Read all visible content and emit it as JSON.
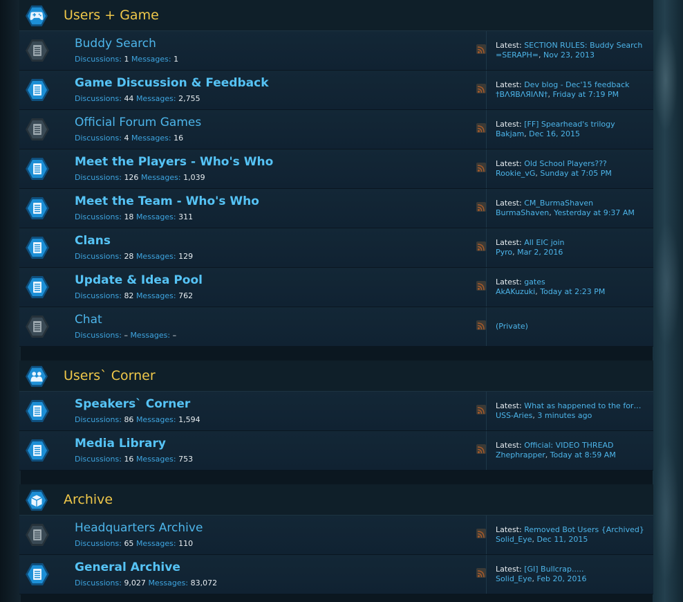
{
  "colors": {
    "category_title": "#f0c84a",
    "link": "#4db5ea",
    "number": "#e8eef2",
    "icon_active": "#1d8fd6",
    "icon_inactive": "#3a4a55"
  },
  "categories": [
    {
      "title": "Users + Game",
      "icon": "gamepad-icon",
      "nodes": [
        {
          "title": "Buddy Search",
          "bold": false,
          "unread": false,
          "discussions": "1",
          "messages": "1",
          "latest_title": "SECTION RULES: Buddy Search",
          "latest_user": "=SERAPH=",
          "latest_date": "Nov 23, 2013"
        },
        {
          "title": "Game Discussion & Feedback",
          "bold": true,
          "unread": true,
          "discussions": "44",
          "messages": "2,755",
          "latest_title": "Dev blog - Dec'15 feedback",
          "latest_user": "†BΛЯBΛЯIΛN†",
          "latest_date": "Friday at 7:19 PM"
        },
        {
          "title": "Official Forum Games",
          "bold": false,
          "unread": false,
          "discussions": "4",
          "messages": "16",
          "latest_title": "[FF] Spearhead's trilogy",
          "latest_user": "Bakjam",
          "latest_date": "Dec 16, 2015"
        },
        {
          "title": "Meet the Players - Who's Who",
          "bold": true,
          "unread": true,
          "discussions": "126",
          "messages": "1,039",
          "latest_title": "Old School Players???",
          "latest_user": "Rookie_vG",
          "latest_date": "Sunday at 7:05 PM"
        },
        {
          "title": "Meet the Team - Who's Who",
          "bold": true,
          "unread": true,
          "discussions": "18",
          "messages": "311",
          "latest_title": "CM_BurmaShaven",
          "latest_user": "BurmaShaven",
          "latest_date": "Yesterday at 9:37 AM"
        },
        {
          "title": "Clans",
          "bold": true,
          "unread": true,
          "discussions": "28",
          "messages": "129",
          "latest_title": "All EIC join",
          "latest_user": "Pyro",
          "latest_date": "Mar 2, 2016"
        },
        {
          "title": "Update & Idea Pool",
          "bold": true,
          "unread": true,
          "discussions": "82",
          "messages": "762",
          "latest_title": "gates",
          "latest_user": "AkAKuzuki",
          "latest_date": "Today at 2:23 PM"
        },
        {
          "title": "Chat",
          "bold": false,
          "unread": false,
          "discussions": "–",
          "messages": "–",
          "private": "(Private)"
        }
      ]
    },
    {
      "title": "Users` Corner",
      "icon": "users-icon",
      "nodes": [
        {
          "title": "Speakers` Corner",
          "bold": true,
          "unread": true,
          "discussions": "86",
          "messages": "1,594",
          "latest_title": "What as happened to the forum",
          "latest_user": "USS-Aries",
          "latest_date": "3 minutes ago"
        },
        {
          "title": "Media Library",
          "bold": true,
          "unread": true,
          "discussions": "16",
          "messages": "753",
          "latest_title": "Official: VIDEO THREAD",
          "latest_user": "Zhephrapper",
          "latest_date": "Today at 8:59 AM"
        }
      ]
    },
    {
      "title": "Archive",
      "icon": "archive-box-icon",
      "nodes": [
        {
          "title": "Headquarters Archive",
          "bold": false,
          "unread": false,
          "discussions": "65",
          "messages": "110",
          "latest_title": "Removed Bot Users {Archived}",
          "latest_user": "Solid_Eye",
          "latest_date": "Dec 11, 2015"
        },
        {
          "title": "General Archive",
          "bold": true,
          "unread": true,
          "discussions": "9,027",
          "messages": "83,072",
          "latest_title": "[GI] Bullcrap.....",
          "latest_user": "Solid_Eye",
          "latest_date": "Feb 20, 2016"
        }
      ]
    }
  ],
  "labels": {
    "discussions": "Discussions:",
    "messages": "Messages:",
    "latest": "Latest:",
    "date_sep": ","
  }
}
